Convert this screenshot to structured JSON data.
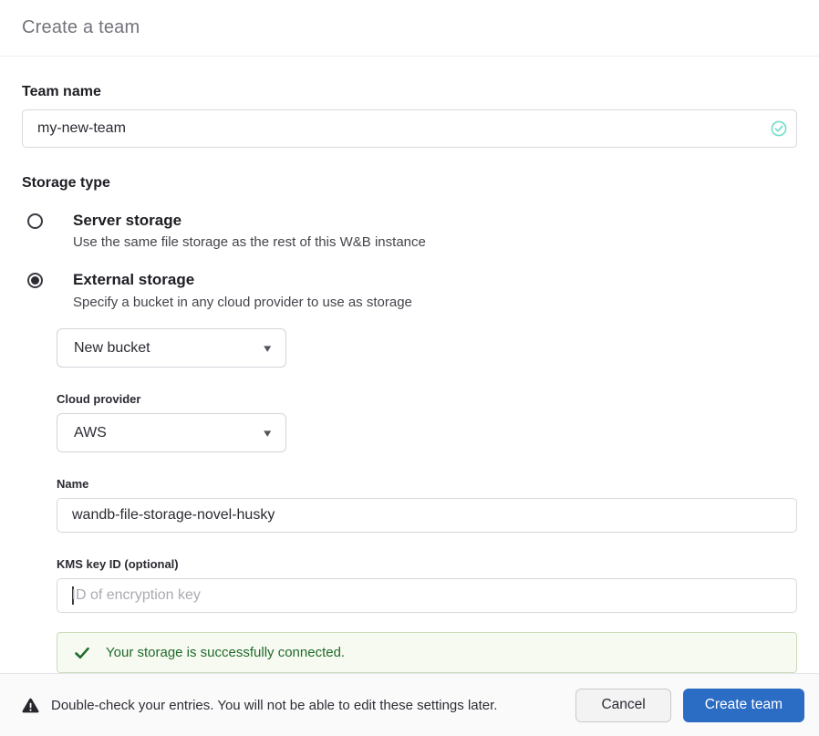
{
  "header": {
    "title": "Create a team"
  },
  "form": {
    "team_name": {
      "label": "Team name",
      "value": "my-new-team"
    },
    "storage_type": {
      "label": "Storage type",
      "options": [
        {
          "title": "Server storage",
          "description": "Use the same file storage as the rest of this W&B instance",
          "selected": false
        },
        {
          "title": "External storage",
          "description": "Specify a bucket in any cloud provider to use as storage",
          "selected": true
        }
      ]
    },
    "bucket_select": {
      "value": "New bucket"
    },
    "cloud_provider": {
      "label": "Cloud provider",
      "value": "AWS"
    },
    "bucket_name": {
      "label": "Name",
      "value": "wandb-file-storage-novel-husky"
    },
    "kms_key": {
      "label": "KMS key ID (optional)",
      "placeholder": "ID of encryption key",
      "value": ""
    },
    "success_message": "Your storage is successfully connected."
  },
  "footer": {
    "warning": "Double-check your entries. You will not be able to edit these settings later.",
    "cancel_label": "Cancel",
    "create_label": "Create team"
  },
  "icons": {
    "caret_down": "▾"
  },
  "colors": {
    "primary_blue": "#2b6cc4",
    "valid_teal": "#72ddc9",
    "success_text_green": "#1f6b2c",
    "success_bg": "#f7faf0",
    "success_border": "#ccdcba",
    "footer_bg": "#fafafb"
  }
}
